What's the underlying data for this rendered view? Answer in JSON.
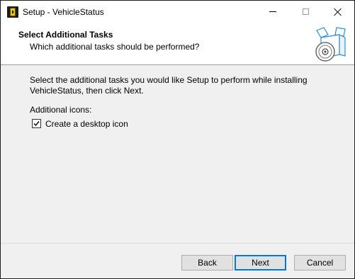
{
  "window": {
    "title": "Setup - VehicleStatus",
    "icon": "app-icon"
  },
  "header": {
    "title": "Select Additional Tasks",
    "subtitle": "Which additional tasks should be performed?",
    "image_icon": "setup-box-disc-icon"
  },
  "content": {
    "description": "Select the additional tasks you would like Setup to perform while installing VehicleStatus, then click Next.",
    "section_label": "Additional icons:",
    "tasks": [
      {
        "label": "Create a desktop icon",
        "checked": true
      }
    ]
  },
  "buttons": {
    "back": "Back",
    "next": "Next",
    "cancel": "Cancel"
  },
  "colors": {
    "accent": "#0078d7",
    "face": "#f0f0f0",
    "header_bg": "#ffffff"
  }
}
